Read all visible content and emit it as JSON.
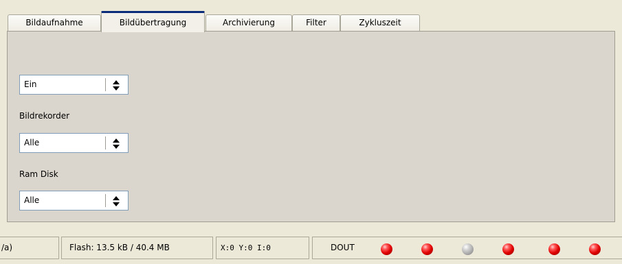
{
  "tabs": [
    {
      "label": "Bildaufnahme"
    },
    {
      "label": "Bildübertragung"
    },
    {
      "label": "Archivierung"
    },
    {
      "label": "Filter"
    },
    {
      "label": "Zykluszeit"
    }
  ],
  "active_tab": "Bildübertragung",
  "panel": {
    "combo_1": {
      "value": "Ein"
    },
    "bildrekorder": {
      "label": "Bildrekorder",
      "value": "Alle"
    },
    "ram_disk": {
      "label": "Ram Disk",
      "value": "Alle"
    }
  },
  "status": {
    "left_text": "/a)",
    "flash": "Flash:  13.5 kB / 40.4 MB",
    "coords": "X:0 Y:0 I:0",
    "dout_label": "DOUT",
    "leds": [
      {
        "state": "on",
        "color": "#e00000"
      },
      {
        "state": "on",
        "color": "#e00000"
      },
      {
        "state": "off",
        "color": "#a6a6a6"
      },
      {
        "state": "on",
        "color": "#e00000"
      },
      {
        "state": "on",
        "color": "#e00000"
      },
      {
        "state": "on",
        "color": "#e00000"
      }
    ]
  }
}
